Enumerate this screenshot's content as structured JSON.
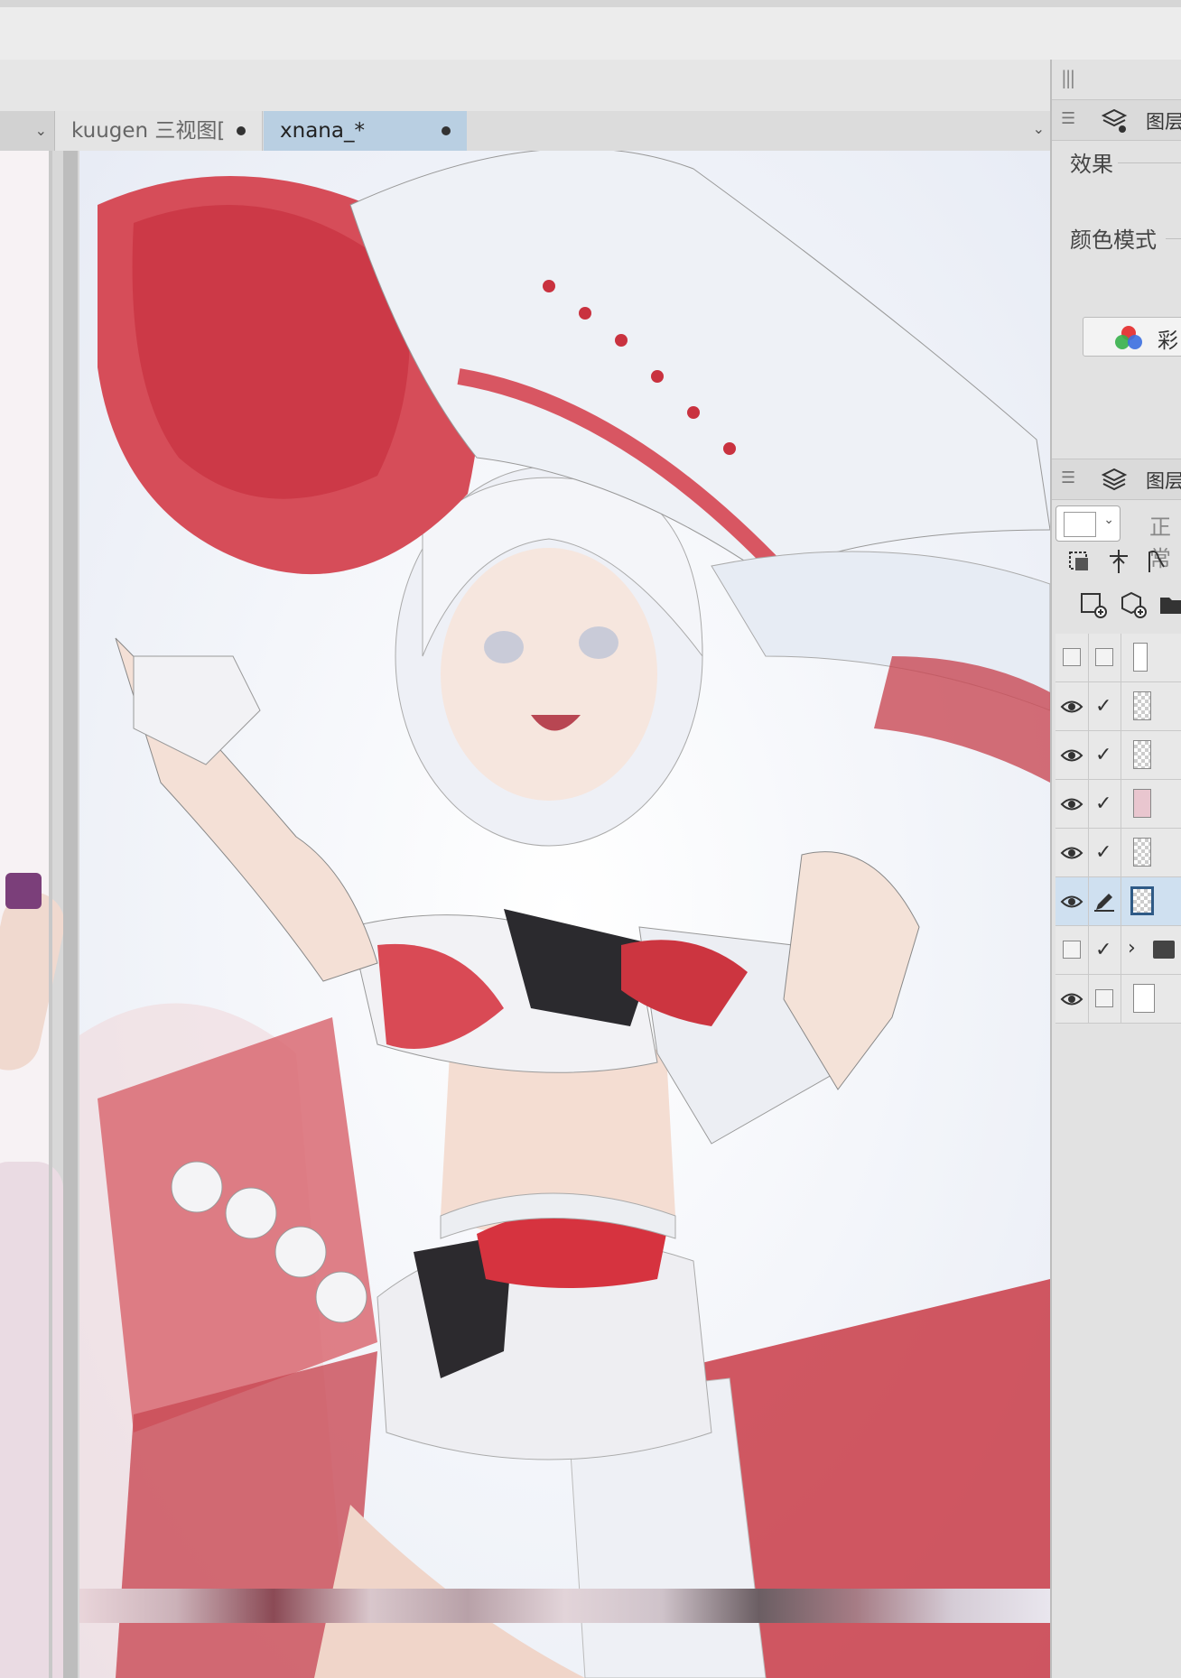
{
  "tabs": [
    {
      "label": "kuugen 三视图[",
      "active": false,
      "modified": true
    },
    {
      "label": "xnana_*",
      "active": true,
      "modified": true
    }
  ],
  "panel_top": {
    "title": "图层",
    "icon": "layer-property-icon",
    "effect_label": "效果",
    "color_mode_label": "颜色模式",
    "color_button_label": "彩"
  },
  "panel_layers": {
    "title": "图层",
    "icon": "layers-icon",
    "blend_mode": "正常",
    "rows": [
      {
        "visible": false,
        "locked_check": false,
        "thumb": "plain-border",
        "selected": false
      },
      {
        "visible": true,
        "locked_check": true,
        "thumb": "transparent",
        "selected": false
      },
      {
        "visible": true,
        "locked_check": true,
        "thumb": "transparent",
        "selected": false
      },
      {
        "visible": true,
        "locked_check": true,
        "thumb": "art",
        "selected": false
      },
      {
        "visible": true,
        "locked_check": true,
        "thumb": "transparent",
        "selected": false
      },
      {
        "visible": true,
        "locked_check": "pen",
        "thumb": "transparent",
        "selected": true
      },
      {
        "visible": false,
        "locked_check": true,
        "thumb": "folder",
        "selected": false
      },
      {
        "visible": true,
        "locked_check": false,
        "thumb": "white",
        "selected": false
      }
    ]
  },
  "colors": {
    "active_tab": "#b9cfe2",
    "selected_layer": "#cfe0f0",
    "accent_red": "#c9323f"
  }
}
